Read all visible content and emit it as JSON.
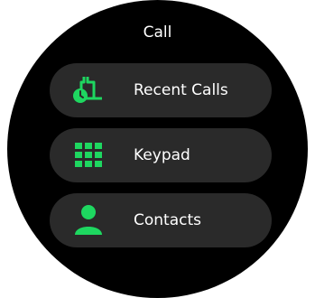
{
  "header": {
    "title": "Call"
  },
  "menu": {
    "items": [
      {
        "label": "Recent Calls",
        "icon": "recent-calls-icon"
      },
      {
        "label": "Keypad",
        "icon": "keypad-icon"
      },
      {
        "label": "Contacts",
        "icon": "contact-person-icon"
      }
    ]
  },
  "colors": {
    "background": "#000000",
    "item_background": "#2a2a2a",
    "accent": "#1ed760",
    "text": "#ffffff"
  }
}
